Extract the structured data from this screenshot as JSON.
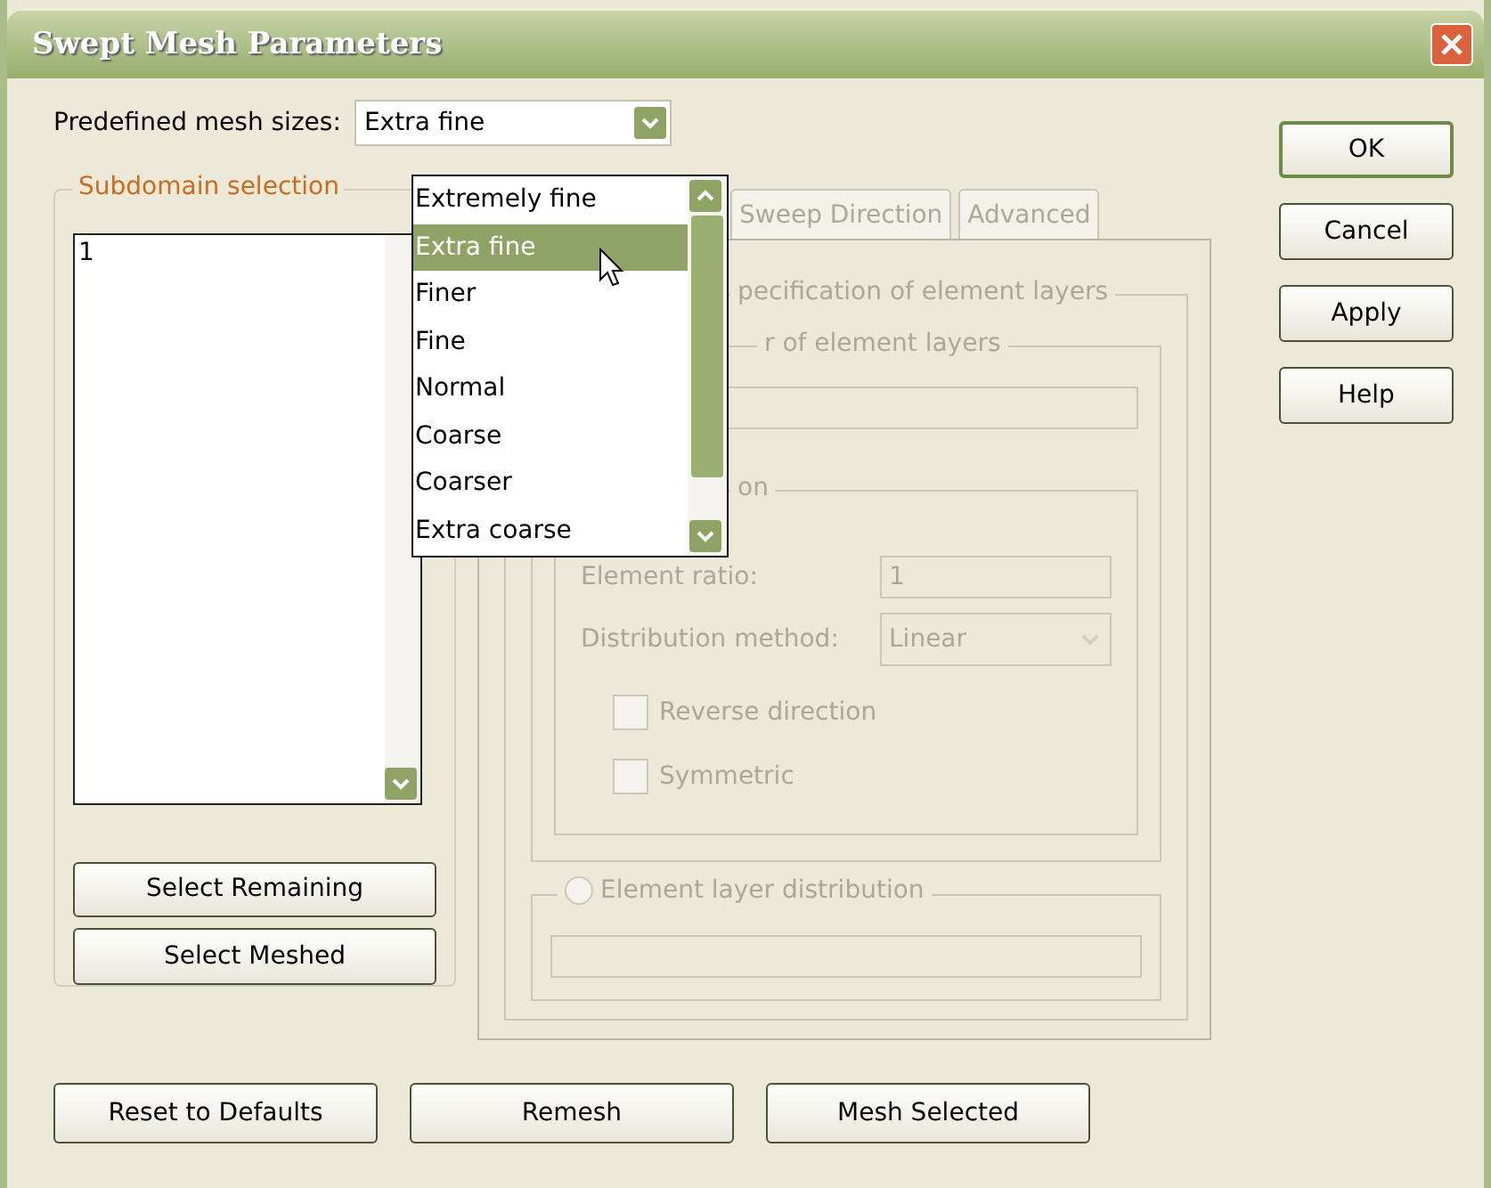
{
  "window": {
    "title": "Swept Mesh Parameters"
  },
  "predefined": {
    "label": "Predefined mesh sizes:",
    "value": "Extra fine",
    "options": [
      {
        "label": "Extremely fine",
        "selected": false
      },
      {
        "label": "Extra fine",
        "selected": true
      },
      {
        "label": "Finer",
        "selected": false
      },
      {
        "label": "Fine",
        "selected": false
      },
      {
        "label": "Normal",
        "selected": false
      },
      {
        "label": "Coarse",
        "selected": false
      },
      {
        "label": "Coarser",
        "selected": false
      },
      {
        "label": "Extra coarse",
        "selected": false
      }
    ]
  },
  "subdomain": {
    "title": "Subdomain selection",
    "items": [
      {
        "label": "1",
        "selected": false
      }
    ],
    "buttons": [
      "Select Remaining",
      "Select Meshed"
    ]
  },
  "tabs": [
    {
      "label": "Sweep Direction",
      "selected": false
    },
    {
      "label": "Advanced",
      "selected": false
    }
  ],
  "panel": {
    "disabled": true,
    "spec_legend": "pecification of element layers",
    "layers_legend": "r of element layers",
    "distribution_legend": "on",
    "ratio_label": "Element ratio:",
    "ratio_value": "1",
    "method_label": "Distribution method:",
    "method_value": "Linear",
    "checkboxes": [
      {
        "label": "Reverse direction",
        "checked": false
      },
      {
        "label": "Symmetric",
        "checked": false
      }
    ],
    "layer_distribution": {
      "label": "Element layer distribution",
      "selected": false
    }
  },
  "side_buttons": [
    {
      "label": "OK",
      "default": true
    },
    {
      "label": "Cancel",
      "default": false
    },
    {
      "label": "Apply",
      "default": false
    },
    {
      "label": "Help",
      "default": false
    }
  ],
  "bottom_buttons": [
    "Reset to Defaults",
    "Remesh",
    "Mesh Selected"
  ]
}
